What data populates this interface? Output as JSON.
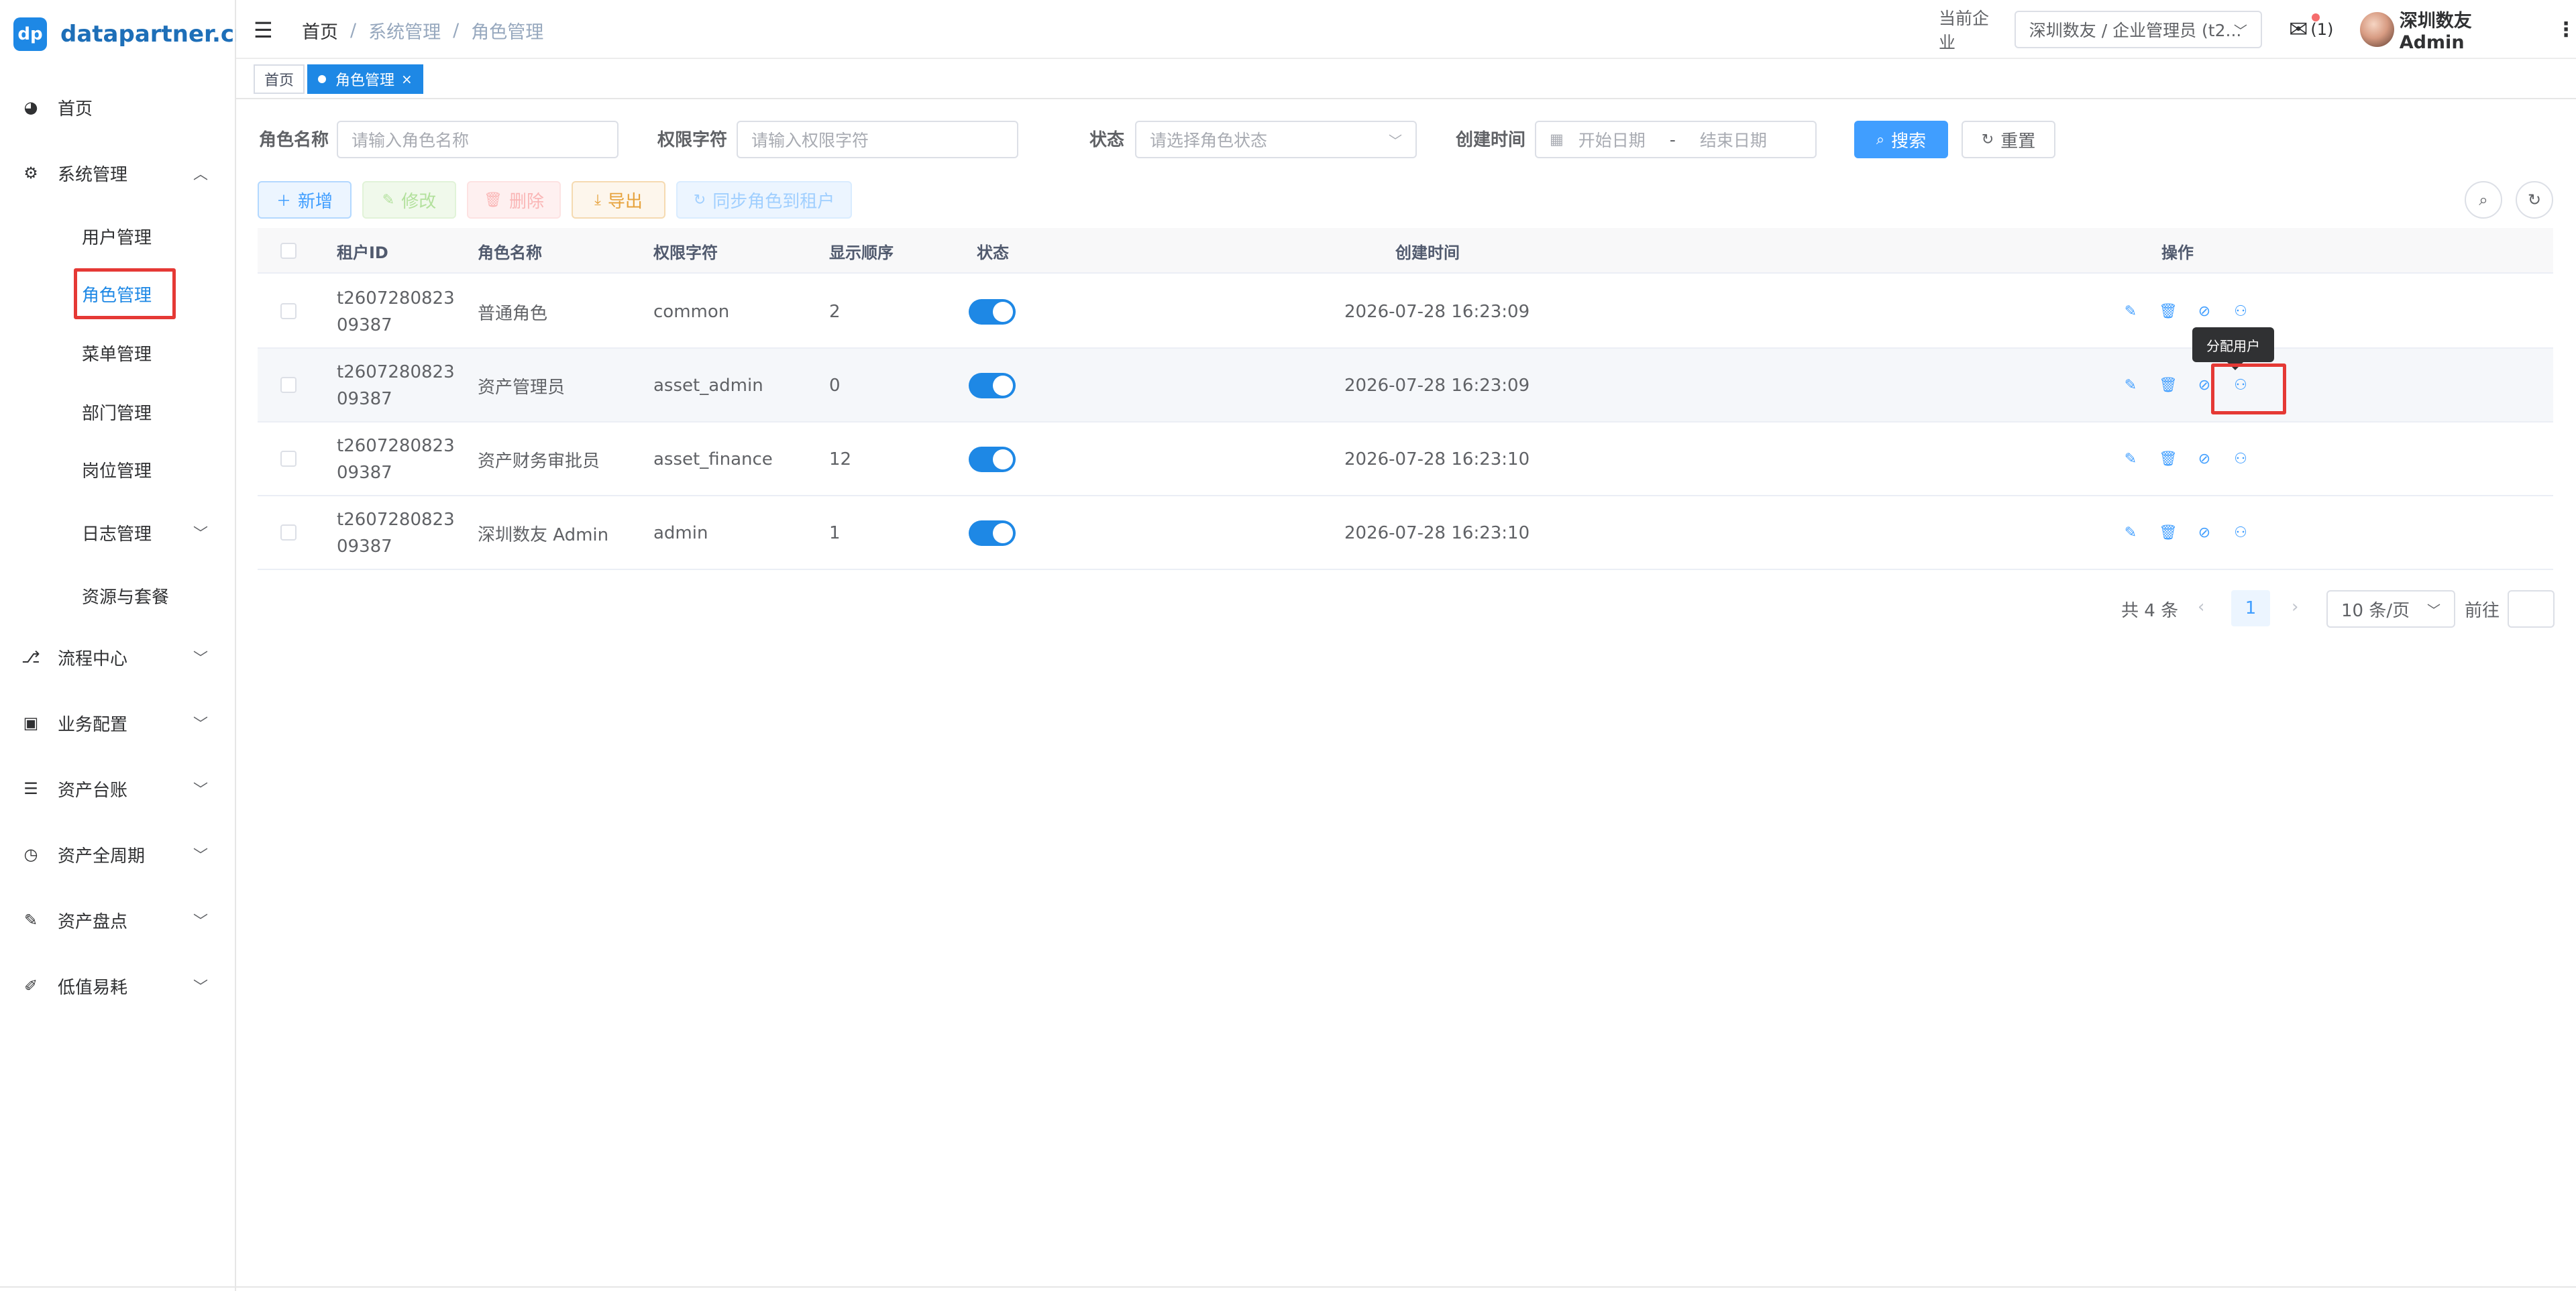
{
  "brand": {
    "badge": "dp",
    "name": "datapartner.cn"
  },
  "sidebar": {
    "items": [
      {
        "icon": "dashboard-icon",
        "glyph": "◕",
        "label": "首页"
      },
      {
        "icon": "gear-icon",
        "glyph": "⚙",
        "label": "系统管理",
        "expanded": true
      },
      {
        "icon": "flow-icon",
        "glyph": "⎇",
        "label": "流程中心"
      },
      {
        "icon": "briefcase-icon",
        "glyph": "▣",
        "label": "业务配置"
      },
      {
        "icon": "list-icon",
        "glyph": "☰",
        "label": "资产台账"
      },
      {
        "icon": "lifecycle-icon",
        "glyph": "◷",
        "label": "资产全周期"
      },
      {
        "icon": "inventory-icon",
        "glyph": "✎",
        "label": "资产盘点"
      },
      {
        "icon": "consumable-icon",
        "glyph": "✐",
        "label": "低值易耗"
      }
    ],
    "sub_items": [
      "用户管理",
      "角色管理",
      "菜单管理",
      "部门管理",
      "岗位管理",
      "日志管理",
      "资源与套餐"
    ]
  },
  "header": {
    "breadcrumb": [
      "首页",
      "系统管理",
      "角色管理"
    ],
    "company_label": "当前企业",
    "company_value": "深圳数友 / 企业管理员 (t2...",
    "mail_count": "(1)",
    "user_name": "深圳数友 Admin"
  },
  "tags": [
    {
      "label": "首页",
      "active": false
    },
    {
      "label": "角色管理",
      "active": true
    }
  ],
  "filters": {
    "role_name_label": "角色名称",
    "role_name_placeholder": "请输入角色名称",
    "perm_label": "权限字符",
    "perm_placeholder": "请输入权限字符",
    "status_label": "状态",
    "status_placeholder": "请选择角色状态",
    "created_label": "创建时间",
    "start_placeholder": "开始日期",
    "date_sep": "-",
    "end_placeholder": "结束日期",
    "search_label": "搜索",
    "reset_label": "重置"
  },
  "toolbar": {
    "add_label": "新增",
    "edit_label": "修改",
    "delete_label": "删除",
    "export_label": "导出",
    "sync_label": "同步角色到租户"
  },
  "table": {
    "headers": [
      "租户ID",
      "角色名称",
      "权限字符",
      "显示顺序",
      "状态",
      "创建时间",
      "操作"
    ],
    "rows": [
      {
        "tenant_id": "t260728082309387",
        "role_name": "普通角色",
        "perm": "common",
        "order": "2",
        "created": "2026-07-28 16:23:09"
      },
      {
        "tenant_id": "t260728082309387",
        "role_name": "资产管理员",
        "perm": "asset_admin",
        "order": "0",
        "created": "2026-07-28 16:23:09"
      },
      {
        "tenant_id": "t260728082309387",
        "role_name": "资产财务审批员",
        "perm": "asset_finance",
        "order": "12",
        "created": "2026-07-28 16:23:10"
      },
      {
        "tenant_id": "t260728082309387",
        "role_name": "深圳数友 Admin",
        "perm": "admin",
        "order": "1",
        "created": "2026-07-28 16:23:10"
      }
    ]
  },
  "tooltip": {
    "text": "分配用户"
  },
  "pagination": {
    "total": "共 4 条",
    "current_page": "1",
    "page_size": "10 条/页",
    "goto_label": "前往"
  },
  "colors": {
    "accent": "#1e88e5",
    "highlight": "#e53935"
  }
}
